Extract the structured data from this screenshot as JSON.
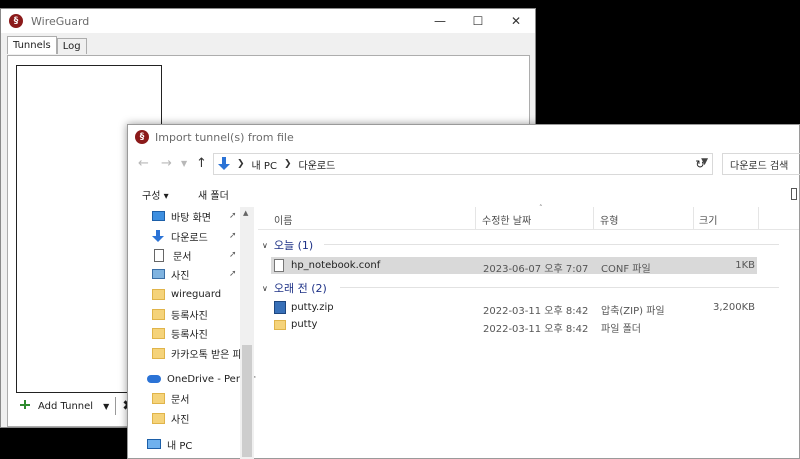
{
  "wireguard": {
    "title": "WireGuard",
    "logo_letter": "§",
    "tabs": [
      {
        "label": "Tunnels"
      },
      {
        "label": "Log"
      }
    ],
    "add_tunnel_label": "Add Tunnel"
  },
  "dialog": {
    "title": "Import tunnel(s) from file",
    "breadcrumb": [
      "내 PC",
      "다운로드"
    ],
    "search_placeholder": "다운로드 검색",
    "toolbar": {
      "organize_label": "구성 ▾",
      "new_folder_label": "새 폴더"
    },
    "nav_items": [
      {
        "label": "바탕 화면",
        "icon": "desktop-icon",
        "pinned": true
      },
      {
        "label": "다운로드",
        "icon": "downloads-icon",
        "pinned": true
      },
      {
        "label": "문서",
        "icon": "document-icon",
        "pinned": true
      },
      {
        "label": "사진",
        "icon": "pictures-icon",
        "pinned": true
      },
      {
        "label": "wireguard",
        "icon": "folder-icon",
        "pinned": false
      },
      {
        "label": "등록사진",
        "icon": "folder-icon",
        "pinned": false
      },
      {
        "label": "등록사진",
        "icon": "folder-icon",
        "pinned": false
      },
      {
        "label": "카카오톡 받은 파",
        "icon": "folder-icon",
        "pinned": false
      },
      {
        "label": "OneDrive - Persor",
        "icon": "onedrive-icon",
        "pinned": false
      },
      {
        "label": "문서",
        "icon": "folder-icon",
        "pinned": false
      },
      {
        "label": "사진",
        "icon": "folder-icon",
        "pinned": false
      },
      {
        "label": "내 PC",
        "icon": "pc-icon",
        "pinned": false
      }
    ],
    "columns": {
      "name": "이름",
      "modified": "수정한 날짜",
      "type": "유형",
      "size": "크기"
    },
    "groups": [
      {
        "label": "오늘 (1)",
        "files": [
          {
            "name": "hp_notebook.conf",
            "modified": "2023-06-07 오후 7:07",
            "type": "CONF 파일",
            "size": "1KB",
            "icon": "file-icon",
            "selected": true
          }
        ]
      },
      {
        "label": "오래 전 (2)",
        "files": [
          {
            "name": "putty.zip",
            "modified": "2022-03-11 오후 8:42",
            "type": "압축(ZIP) 파일",
            "size": "3,200KB",
            "icon": "zip-icon",
            "selected": false
          },
          {
            "name": "putty",
            "modified": "2022-03-11 오후 8:42",
            "type": "파일 폴더",
            "size": "",
            "icon": "folder-icon",
            "selected": false
          }
        ]
      }
    ]
  }
}
